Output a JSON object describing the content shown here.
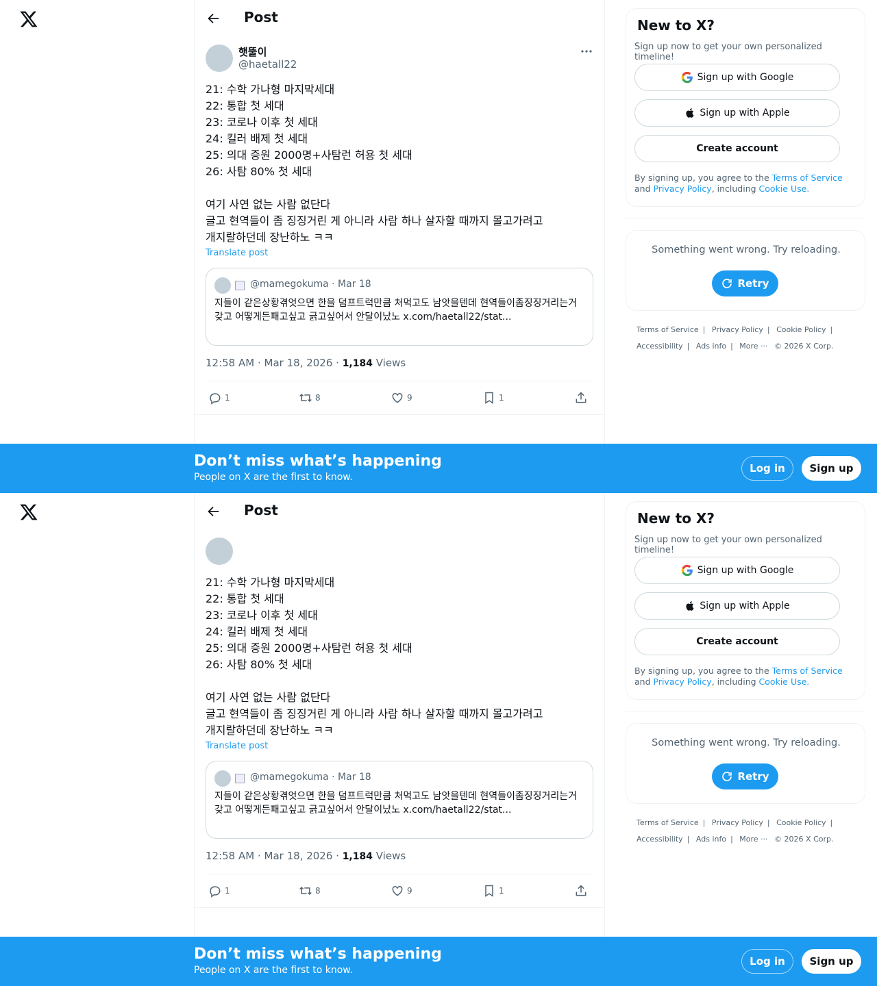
{
  "nav": {
    "back_label": "Back",
    "title": "Post"
  },
  "post": {
    "author_name": "햇뚤이",
    "author_handle": "@haetall22",
    "text": "21: 수학 가나형 마지막세대\n22: 통합 첫 세대\n23: 코로나 이후 첫 세대\n24: 킬러 배제 첫 세대\n25: 의대 증원 2000명+사탐런 허용 첫 세대\n26: 사탐 80% 첫 세대\n\n여기 사연 없는 사람 없단다\n글고 현역들이 좀 징징거린 게 아니라 사람 하나 살자할 때까지 몰고가려고\n개지랄하던데 장난하노 ㅋㅋ",
    "translate_label": "Translate post",
    "quote": {
      "handle_date": "@mamegokuma · Mar 18",
      "text": "지들이 같은상황겪엇으면 한을 덤프트럭만큼 처먹고도 남앗을텐데 현역들이좀징징거리는거갖고 어떻게든패고싶고 긁고싶어서 안달이났노 x.com/haetall22/stat..."
    },
    "timestamp": "12:58 AM · Mar 18, 2026 · ",
    "views_count": "1,184",
    "views_label": " Views",
    "replies": "1",
    "reposts": "8",
    "likes": "9",
    "bookmarks": "1"
  },
  "signup_card": {
    "heading": "New to X?",
    "subtext": "Sign up now to get your own personalized timeline!",
    "google_label": "Sign up with Google",
    "apple_label": "Sign up with Apple",
    "create_label": "Create account",
    "terms_pre": "By signing up, you agree to the ",
    "terms_link": "Terms of Service",
    "terms_and": " and ",
    "privacy_link": "Privacy Policy",
    "terms_mid": ", including ",
    "cookie_link": "Cookie Use."
  },
  "error_card": {
    "message": "Something went wrong. Try reloading.",
    "retry_label": "Retry"
  },
  "footer": {
    "terms": "Terms of Service",
    "privacy": "Privacy Policy",
    "cookie": "Cookie Policy",
    "accessibility": "Accessibility",
    "ads": "Ads info",
    "more": "More ···",
    "copyright": "© 2026 X Corp."
  },
  "banner": {
    "heading": "Don’t miss what’s happening",
    "subtext": "People on X are the first to know.",
    "login_label": "Log in",
    "signup_label": "Sign up"
  },
  "colors": {
    "accent": "#1d9bf0",
    "text": "#0f1419",
    "muted": "#536471"
  }
}
